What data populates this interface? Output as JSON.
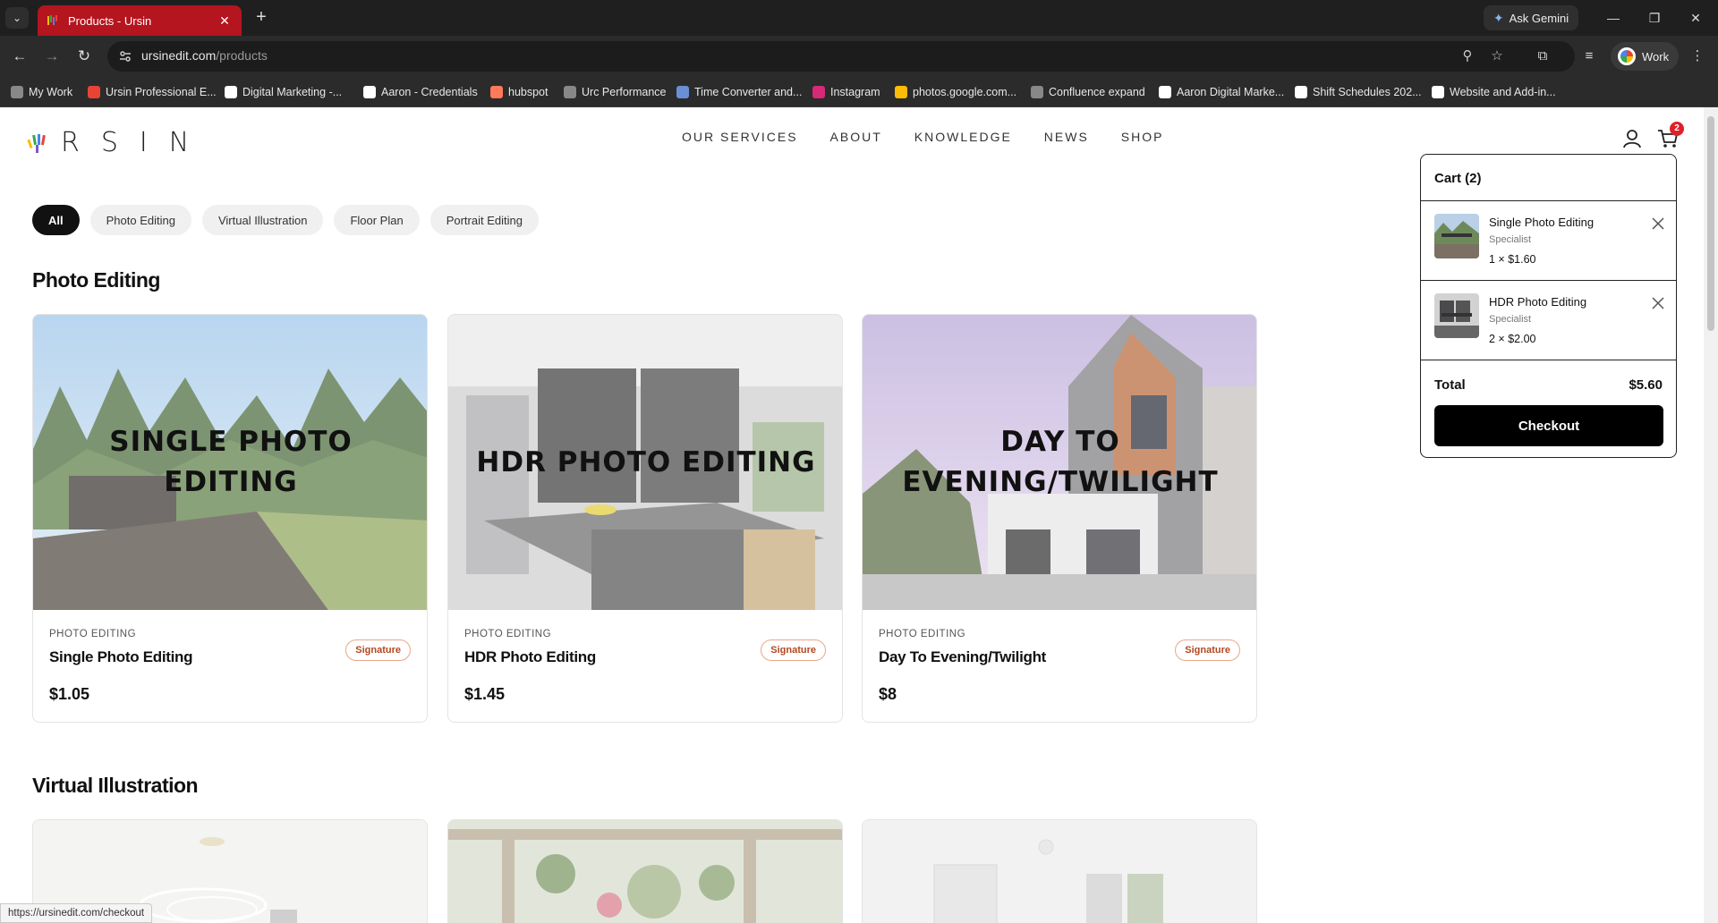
{
  "browser": {
    "tab_title": "Products - Ursin",
    "url_host": "ursinedit.com",
    "url_path": "/products",
    "gemini_label": "Ask Gemini",
    "profile_label": "Work",
    "status_url": "https://ursinedit.com/checkout",
    "bookmarks": [
      {
        "label": "My Work",
        "color": "#888888"
      },
      {
        "label": "Ursin Professional E...",
        "color": "#ea4335"
      },
      {
        "label": "Digital Marketing -...",
        "color": "#ffffff"
      },
      {
        "label": "Aaron - Credentials",
        "color": "#ffffff"
      },
      {
        "label": "hubspot",
        "color": "#ff7a59"
      },
      {
        "label": "Urc Performance",
        "color": "#888888"
      },
      {
        "label": "Time Converter and...",
        "color": "#6b8fd6"
      },
      {
        "label": "Instagram",
        "color": "#d62976"
      },
      {
        "label": "photos.google.com...",
        "color": "#fbbc05"
      },
      {
        "label": "Confluence expand",
        "color": "#888888"
      },
      {
        "label": "Aaron Digital Marke...",
        "color": "#ffffff"
      },
      {
        "label": "Shift Schedules 202...",
        "color": "#ffffff"
      },
      {
        "label": "Website and Add-in...",
        "color": "#ffffff"
      }
    ]
  },
  "site": {
    "logo_text": "RSIN",
    "nav": [
      "OUR SERVICES",
      "ABOUT",
      "KNOWLEDGE",
      "NEWS",
      "SHOP"
    ],
    "cart_count": "2"
  },
  "filters": [
    {
      "label": "All",
      "active": true
    },
    {
      "label": "Photo Editing",
      "active": false
    },
    {
      "label": "Virtual Illustration",
      "active": false
    },
    {
      "label": "Floor Plan",
      "active": false
    },
    {
      "label": "Portrait Editing",
      "active": false
    }
  ],
  "sections": {
    "photo_editing": "Photo Editing",
    "virtual_illustration": "Virtual Illustration"
  },
  "products": [
    {
      "caption": "SINGLE PHOTO EDITING",
      "category": "PHOTO EDITING",
      "name": "Single Photo Editing",
      "badge": "Signature",
      "price": "$1.05"
    },
    {
      "caption": "HDR PHOTO EDITING",
      "category": "PHOTO EDITING",
      "name": "HDR Photo Editing",
      "badge": "Signature",
      "price": "$1.45"
    },
    {
      "caption": "DAY TO EVENING/TWILIGHT",
      "category": "PHOTO EDITING",
      "name": "Day To Evening/Twilight",
      "badge": "Signature",
      "price": "$8"
    }
  ],
  "cart": {
    "title": "Cart (2)",
    "items": [
      {
        "name": "Single Photo Editing",
        "variant": "Specialist",
        "qty": "1 × $1.60"
      },
      {
        "name": "HDR Photo Editing",
        "variant": "Specialist",
        "qty": "2 × $2.00"
      }
    ],
    "total_label": "Total",
    "total_value": "$5.60",
    "checkout_label": "Checkout"
  },
  "colors": {
    "tab_active": "#b5151f",
    "badge_border": "#e9a68a",
    "badge_text": "#b4471f",
    "cart_badge": "#e0202a"
  }
}
